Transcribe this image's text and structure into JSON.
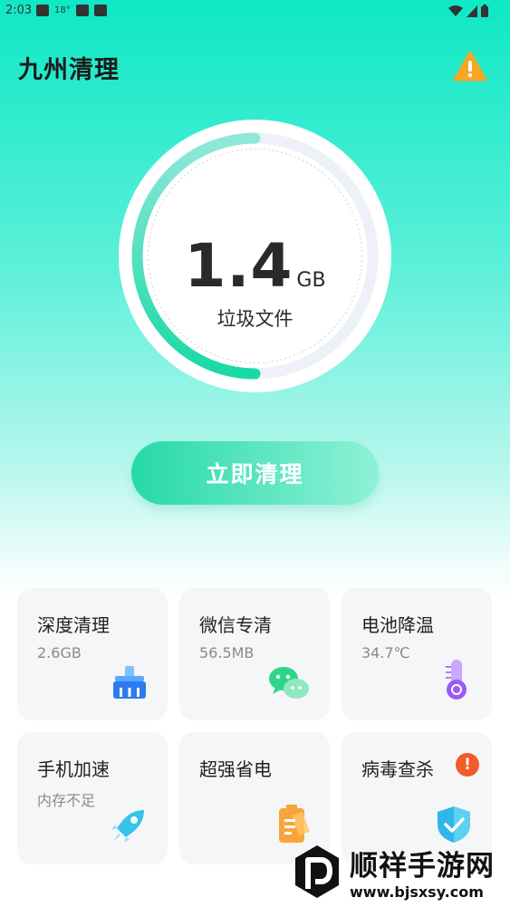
{
  "status_bar": {
    "time": "2:03",
    "temp": "18°"
  },
  "header": {
    "title": "九州清理"
  },
  "dial": {
    "value": "1.4",
    "unit": "GB",
    "label": "垃圾文件",
    "progress": 0.5
  },
  "primary_action": {
    "label": "立即清理"
  },
  "cards": [
    {
      "title": "深度清理",
      "subtitle": "2.6GB"
    },
    {
      "title": "微信专清",
      "subtitle": "56.5MB"
    },
    {
      "title": "电池降温",
      "subtitle": "34.7℃"
    },
    {
      "title": "手机加速",
      "subtitle": "内存不足"
    },
    {
      "title": "超强省电",
      "subtitle": ""
    },
    {
      "title": "病毒查杀",
      "subtitle": "",
      "badge": "!"
    }
  ],
  "watermark": {
    "name": "顺祥手游网",
    "url": "www.bjsxsy.com"
  },
  "colors": {
    "accent": "#1fd8a6",
    "warning": "#f5a623",
    "alert": "#f25b2a"
  },
  "icons": [
    "warning-icon",
    "broom-icon",
    "wechat-icon",
    "thermometer-icon",
    "rocket-icon",
    "battery-icon",
    "shield-icon"
  ]
}
